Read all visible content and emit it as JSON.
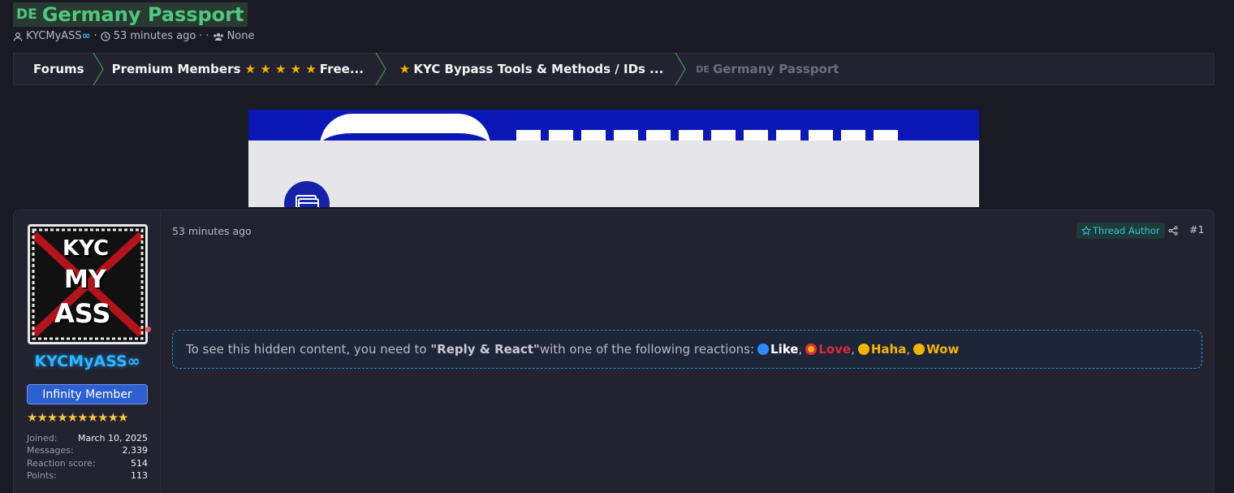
{
  "thread": {
    "flag": "DE",
    "title": "Germany Passport",
    "author": "KYCMyASS",
    "author_suffix": "∞",
    "time": "53 minutes ago",
    "separator": "·",
    "participants": "None"
  },
  "breadcrumb": [
    {
      "label": "Forums"
    },
    {
      "label": "Premium Members",
      "stars": "★ ★ ★ ★ ★",
      "suffix": "Free..."
    },
    {
      "label": "KYC Bypass Tools & Methods / IDs ...",
      "star": "★"
    },
    {
      "flag": "DE",
      "label": "Germany Passport"
    }
  ],
  "colors": {
    "accent_green": "#4ec97c",
    "accent_blue": "#2eb7ff",
    "background": "#191a23",
    "panel": "#22232e"
  },
  "user": {
    "avatar_lines": [
      "KYC",
      "MY",
      "ASS"
    ],
    "name": "KYCMyASS∞",
    "rank": "Infinity Member",
    "stars": "★★★★★★★★★★",
    "stats": [
      {
        "key": "Joined:",
        "value": "March 10, 2025"
      },
      {
        "key": "Messages:",
        "value": "2,339"
      },
      {
        "key": "Reaction score:",
        "value": "514"
      },
      {
        "key": "Points:",
        "value": "113"
      }
    ]
  },
  "post": {
    "date": "53 minutes ago",
    "badge": "Thread Author",
    "number": "#1",
    "hidden_prefix": "To see this hidden content, you need to ",
    "hidden_action": "\"Reply & React\"",
    "hidden_suffix": " with one of the following reactions: ",
    "reactions": [
      "Like",
      "Love",
      "Haha",
      "Wow"
    ]
  },
  "icons": {
    "author": "user-icon",
    "time": "clock-icon",
    "participants": "users-icon",
    "share": "share-icon",
    "badge": "star-outline-icon"
  }
}
